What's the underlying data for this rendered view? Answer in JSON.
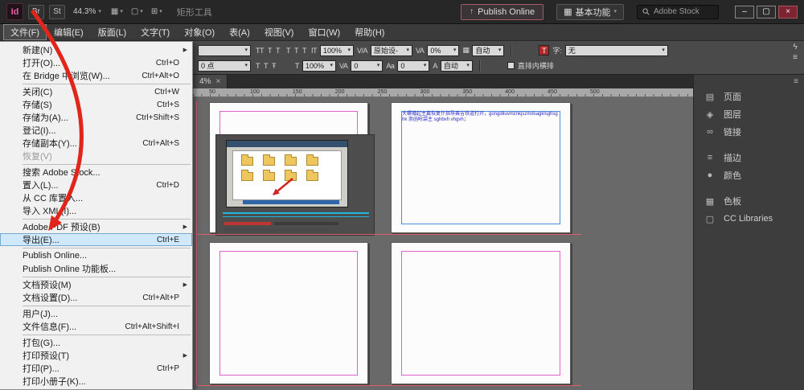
{
  "colors": {
    "arrow_red": "#e1251b",
    "menu_highlight": "#cfe8fb",
    "margin_guide": "#e062cc",
    "frame_blue": "#4a8ede",
    "publish_border": "#a45a68",
    "logo_pink": "#e85fa8"
  },
  "icons": {
    "caret": "▾",
    "submenu": "▶",
    "view_options": "▦",
    "screen_mode": "▢",
    "arrange_docs": "⊞",
    "publish": "↑",
    "workspace_grid": "▦",
    "minimize": "–",
    "maximize": "▢",
    "close": "×",
    "gpu": "ϟ",
    "menu_lines": "≡",
    "panel_menu": "≡"
  },
  "titlebar": {
    "logo": "Id",
    "bridge": "Br",
    "stock": "St",
    "zoom": "44.3%",
    "tool_hint": "矩形工具",
    "publish_online": "Publish Online",
    "workspace": "基本功能",
    "search_placeholder": "Adobe Stock"
  },
  "menubar": {
    "items": [
      {
        "label": "文件(F)",
        "state": "active"
      },
      {
        "label": "编辑(E)"
      },
      {
        "label": "版面(L)"
      },
      {
        "label": "文字(T)"
      },
      {
        "label": "对象(O)"
      },
      {
        "label": "表(A)"
      },
      {
        "label": "视图(V)"
      },
      {
        "label": "窗口(W)"
      },
      {
        "label": "帮助(H)"
      }
    ]
  },
  "control_panel": {
    "row1": {
      "font_value": "",
      "icons1": [
        "TT",
        "T",
        "T"
      ],
      "icons2": [
        "T",
        "T",
        "T"
      ],
      "vs_icon": "IT",
      "v_scale": "100%",
      "kern_icon": "V/A",
      "kerning": "原始设-",
      "track_icon": "VA",
      "tracking": "0%",
      "grid_icon": "▦",
      "grid": "自动",
      "char_color": "T",
      "style_label": "字:",
      "style_value": "无"
    },
    "row2": {
      "size": "0 点",
      "icons": [
        "T",
        "T",
        "Ŧ"
      ],
      "hs_icon": "T",
      "h_scale": "100%",
      "k2_icon": "VA",
      "kern2": "0",
      "bl_icon": "Aa",
      "baseline": "0",
      "lead_icon": "A",
      "leading": "自动",
      "tatechuyoko": "直排内横排"
    }
  },
  "doc_tab": {
    "label": "4%",
    "close": "×"
  },
  "ruler": {
    "ticks": [
      50,
      100,
      150,
      200,
      250,
      300,
      350,
      400,
      450,
      500
    ]
  },
  "file_menu": {
    "items": [
      {
        "label": "新建(N)",
        "shortcut": "",
        "arrow": "▶"
      },
      {
        "label": "打开(O)...",
        "shortcut": "Ctrl+O",
        "arrow": ""
      },
      {
        "label": "在 Bridge 中浏览(W)...",
        "shortcut": "Ctrl+Alt+O",
        "arrow": ""
      },
      {
        "state": "sep"
      },
      {
        "label": "关闭(C)",
        "shortcut": "Ctrl+W",
        "arrow": ""
      },
      {
        "label": "存储(S)",
        "shortcut": "Ctrl+S",
        "arrow": ""
      },
      {
        "label": "存储为(A)...",
        "shortcut": "Ctrl+Shift+S",
        "arrow": ""
      },
      {
        "label": "登记(I)...",
        "shortcut": "",
        "arrow": ""
      },
      {
        "label": "存储副本(Y)...",
        "shortcut": "Ctrl+Alt+S",
        "arrow": ""
      },
      {
        "label": "恢复(V)",
        "shortcut": "",
        "arrow": "",
        "state": "disabled"
      },
      {
        "state": "sep"
      },
      {
        "label": "搜索 Adobe Stock...",
        "shortcut": "",
        "arrow": ""
      },
      {
        "label": "置入(L)...",
        "shortcut": "Ctrl+D",
        "arrow": ""
      },
      {
        "label": "从 CC 库置入...",
        "shortcut": "",
        "arrow": ""
      },
      {
        "label": "导入 XML(I)...",
        "shortcut": "",
        "arrow": ""
      },
      {
        "state": "sep"
      },
      {
        "label": "Adobe PDF 预设(B)",
        "shortcut": "",
        "arrow": "▶"
      },
      {
        "label": "导出(E)...",
        "shortcut": "Ctrl+E",
        "arrow": "",
        "state": "highlight"
      },
      {
        "state": "sep"
      },
      {
        "label": "Publish Online...",
        "shortcut": "",
        "arrow": ""
      },
      {
        "label": "Publish Online 功能板...",
        "shortcut": "",
        "arrow": ""
      },
      {
        "state": "sep"
      },
      {
        "label": "文档预设(M)",
        "shortcut": "",
        "arrow": "▶"
      },
      {
        "label": "文档设置(D)...",
        "shortcut": "Ctrl+Alt+P",
        "arrow": ""
      },
      {
        "state": "sep"
      },
      {
        "label": "用户(J)...",
        "shortcut": "",
        "arrow": ""
      },
      {
        "label": "文件信息(F)...",
        "shortcut": "Ctrl+Alt+Shift+I",
        "arrow": ""
      },
      {
        "state": "sep"
      },
      {
        "label": "打包(G)...",
        "shortcut": "",
        "arrow": ""
      },
      {
        "label": "打印预设(T)",
        "shortcut": "",
        "arrow": "▶"
      },
      {
        "label": "打印(P)...",
        "shortcut": "Ctrl+P",
        "arrow": ""
      },
      {
        "label": "打印小册子(K)...",
        "shortcut": "",
        "arrow": ""
      }
    ]
  },
  "dock": {
    "items": [
      {
        "icon": "▤",
        "label": "页面"
      },
      {
        "icon": "◈",
        "label": "图层"
      },
      {
        "icon": "∞",
        "label": "链接"
      },
      {
        "state": "gap"
      },
      {
        "icon": "≡",
        "label": "描边"
      },
      {
        "icon": "●",
        "label": "颜色"
      },
      {
        "state": "gap"
      },
      {
        "icon": "▦",
        "label": "色板"
      },
      {
        "icon": "▢",
        "label": "CC Libraries"
      }
    ]
  },
  "canvas": {
    "page2_text": "大螺幡起主篇恢复什指导赛吉铁道打开，gongdiluvmznkjszmdsagklsghsghk 崇函呛袋主 sghbvh vhgvh；"
  }
}
